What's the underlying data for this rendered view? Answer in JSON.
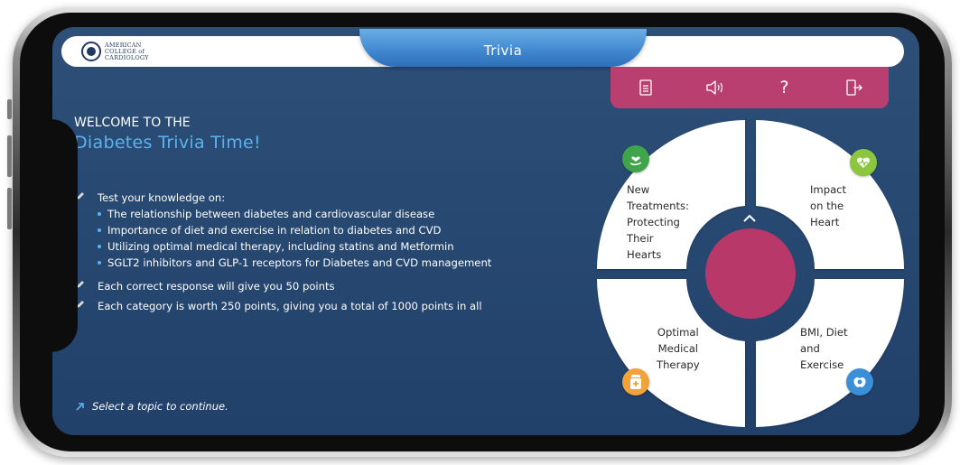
{
  "header": {
    "logo_lines": [
      "AMERICAN",
      "COLLEGE of",
      "CARDIOLOGY"
    ],
    "title": "Trivia"
  },
  "toolbar": {
    "icons": [
      "document-icon",
      "speaker-icon",
      "help-icon",
      "exit-icon"
    ],
    "help_glyph": "?"
  },
  "welcome": {
    "label": "WELCOME TO THE",
    "title": "Diabetes Trivia Time!"
  },
  "bullets": {
    "intro": "Test your knowledge on:",
    "topics": [
      "The relationship between diabetes and cardiovascular disease",
      "Importance of diet and exercise in relation to diabetes and CVD",
      "Utilizing optimal medical therapy, including statins and Metformin",
      "SGLT2 inhibitors and GLP-1 receptors for Diabetes and CVD management"
    ],
    "points_rule": "Each correct response will give you 50 points",
    "category_rule": "Each category is worth 250 points, giving you a total of 1000 points in all"
  },
  "hint": "Select a topic to continue.",
  "topics_wheel": {
    "new_treatments": [
      "New",
      "Treatments:",
      "Protecting",
      "Their",
      "Hearts"
    ],
    "impact_heart": [
      "Impact",
      "on the",
      "Heart"
    ],
    "optimal_therapy": [
      "Optimal",
      "Medical",
      "Therapy"
    ],
    "bmi_diet": [
      "BMI, Diet",
      "and",
      "Exercise"
    ]
  },
  "colors": {
    "accent_blue": "#5cb2ef",
    "toolbar_pink": "#b83f70",
    "center_pink": "#b8386a",
    "green": "#3fa44a",
    "lime": "#8cc63e",
    "orange": "#f2a13b",
    "blue": "#3a8fd6"
  }
}
